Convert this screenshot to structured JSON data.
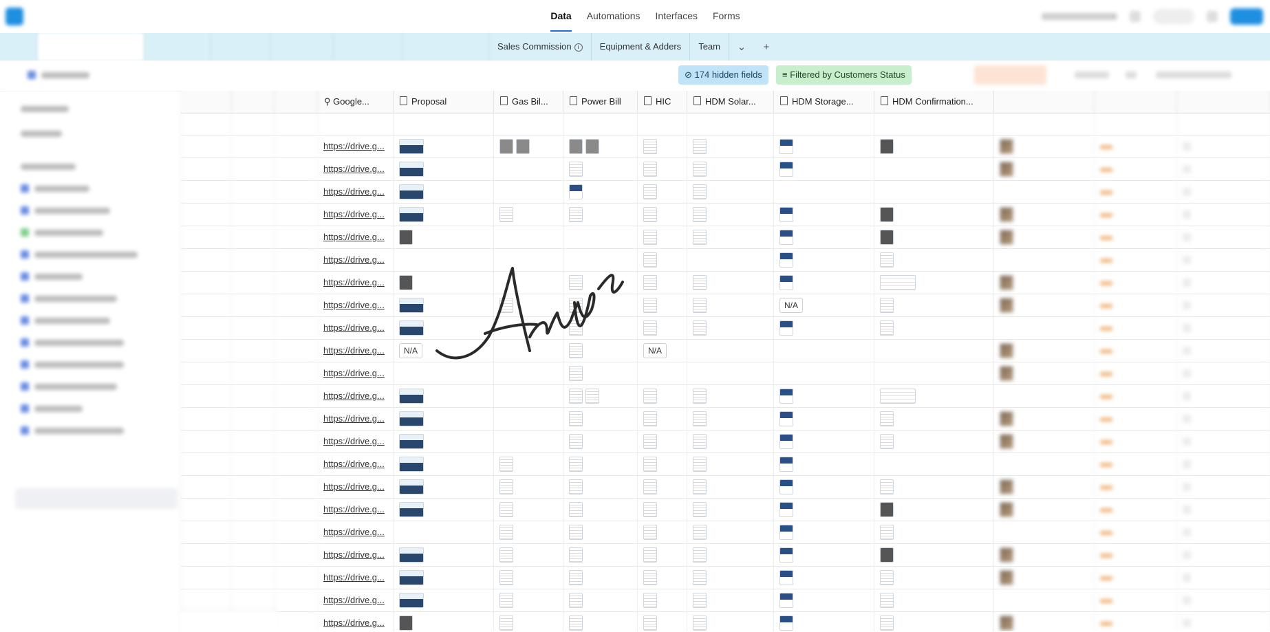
{
  "topbar": {
    "nav": [
      {
        "label": "Data",
        "active": true
      },
      {
        "label": "Automations",
        "active": false
      },
      {
        "label": "Interfaces",
        "active": false
      },
      {
        "label": "Forms",
        "active": false
      }
    ]
  },
  "tabs": [
    {
      "label": "Sales Commission",
      "info": true
    },
    {
      "label": "Equipment & Adders",
      "info": false
    },
    {
      "label": "Team",
      "info": false
    }
  ],
  "tabs_misc": {
    "more_icon": "chevron-down-icon",
    "add_icon": "plus-icon",
    "add_label": "+"
  },
  "toolbar": {
    "hidden_fields": "174 hidden fields",
    "filtered": "Filtered by Customers Status"
  },
  "columns": [
    "Google...",
    "Proposal",
    "Gas Bil...",
    "Power Bill",
    "HIC",
    "HDM Solar...",
    "HDM Storage...",
    "HDM Confirmation..."
  ],
  "rows": [
    {
      "link": "",
      "proposal": "",
      "gas": 0,
      "power": 0,
      "hic": "",
      "solar": "",
      "storage": "",
      "conf": ""
    },
    {
      "link": "https://drive.g...",
      "proposal": "img",
      "gas": 2,
      "power": 2,
      "hic": "doc",
      "solar": "doc",
      "storage": "hdm",
      "conf": "dark"
    },
    {
      "link": "https://drive.g...",
      "proposal": "img",
      "gas": 0,
      "power": 1,
      "hic": "doc",
      "solar": "doc",
      "storage": "hdm",
      "conf": ""
    },
    {
      "link": "https://drive.g...",
      "proposal": "img",
      "gas": 0,
      "power": 1,
      "hic": "doc",
      "solar": "doc",
      "storage": "",
      "conf": ""
    },
    {
      "link": "https://drive.g...",
      "proposal": "img",
      "gas": 1,
      "power": 1,
      "hic": "doc",
      "solar": "doc",
      "storage": "hdm",
      "conf": "dark"
    },
    {
      "link": "https://drive.g...",
      "proposal": "small",
      "gas": 0,
      "power": 0,
      "hic": "doc",
      "solar": "doc",
      "storage": "hdm",
      "conf": "dark"
    },
    {
      "link": "https://drive.g...",
      "proposal": "",
      "gas": 0,
      "power": 0,
      "hic": "doc",
      "solar": "",
      "storage": "hdm",
      "conf": "doc"
    },
    {
      "link": "https://drive.g...",
      "proposal": "small",
      "gas": 0,
      "power": 1,
      "hic": "doc",
      "solar": "doc",
      "storage": "hdm",
      "conf": "wide"
    },
    {
      "link": "https://drive.g...",
      "proposal": "img",
      "gas": 1,
      "power": 1,
      "hic": "doc",
      "solar": "doc",
      "storage": "N/A",
      "conf": "doc"
    },
    {
      "link": "https://drive.g...",
      "proposal": "img",
      "gas": 0,
      "power": 1,
      "hic": "doc",
      "solar": "doc",
      "storage": "hdm",
      "conf": "doc"
    },
    {
      "link": "https://drive.g...",
      "proposal": "N/A",
      "gas": 0,
      "power": 1,
      "hic": "N/A",
      "solar": "",
      "storage": "",
      "conf": ""
    },
    {
      "link": "https://drive.g...",
      "proposal": "",
      "gas": 0,
      "power": 1,
      "hic": "",
      "solar": "",
      "storage": "",
      "conf": ""
    },
    {
      "link": "https://drive.g...",
      "proposal": "img",
      "gas": 0,
      "power": 2,
      "hic": "doc",
      "solar": "doc",
      "storage": "hdm",
      "conf": "wide"
    },
    {
      "link": "https://drive.g...",
      "proposal": "img",
      "gas": 0,
      "power": 1,
      "hic": "doc",
      "solar": "doc",
      "storage": "hdm",
      "conf": "doc"
    },
    {
      "link": "https://drive.g...",
      "proposal": "img",
      "gas": 0,
      "power": 1,
      "hic": "doc",
      "solar": "doc",
      "storage": "hdm",
      "conf": "doc"
    },
    {
      "link": "https://drive.g...",
      "proposal": "img",
      "gas": 1,
      "power": 1,
      "hic": "doc",
      "solar": "doc",
      "storage": "hdm",
      "conf": ""
    },
    {
      "link": "https://drive.g...",
      "proposal": "img",
      "gas": 1,
      "power": 1,
      "hic": "doc",
      "solar": "doc",
      "storage": "hdm",
      "conf": "doc"
    },
    {
      "link": "https://drive.g...",
      "proposal": "img",
      "gas": 1,
      "power": 1,
      "hic": "doc",
      "solar": "doc",
      "storage": "hdm",
      "conf": "dark"
    },
    {
      "link": "https://drive.g...",
      "proposal": "",
      "gas": 1,
      "power": 1,
      "hic": "doc",
      "solar": "doc",
      "storage": "hdm",
      "conf": "doc"
    },
    {
      "link": "https://drive.g...",
      "proposal": "img",
      "gas": 1,
      "power": 1,
      "hic": "doc",
      "solar": "doc",
      "storage": "hdm",
      "conf": "dark"
    },
    {
      "link": "https://drive.g...",
      "proposal": "img",
      "gas": 1,
      "power": 1,
      "hic": "doc",
      "solar": "doc",
      "storage": "hdm",
      "conf": "doc"
    },
    {
      "link": "https://drive.g...",
      "proposal": "img",
      "gas": 1,
      "power": 1,
      "hic": "doc",
      "solar": "doc",
      "storage": "hdm",
      "conf": "doc"
    },
    {
      "link": "https://drive.g...",
      "proposal": "small",
      "gas": 1,
      "power": 1,
      "hic": "doc",
      "solar": "doc",
      "storage": "hdm",
      "conf": "doc"
    },
    {
      "link": "https://drive.g...",
      "proposal": "small",
      "gas": 1,
      "power": 1,
      "hic": "doc",
      "solar": "doc",
      "storage": "hdm",
      "conf": "doc"
    }
  ],
  "signature": {
    "text": "Anuya",
    "image": "handwritten-signature"
  },
  "colors": {
    "accent": "#1f8fe0",
    "tabbar": "#daf0f8",
    "hidden_btn": "#bfe3f7",
    "filter_btn": "#c7efcd",
    "sort_btn": "#fde3d3"
  }
}
